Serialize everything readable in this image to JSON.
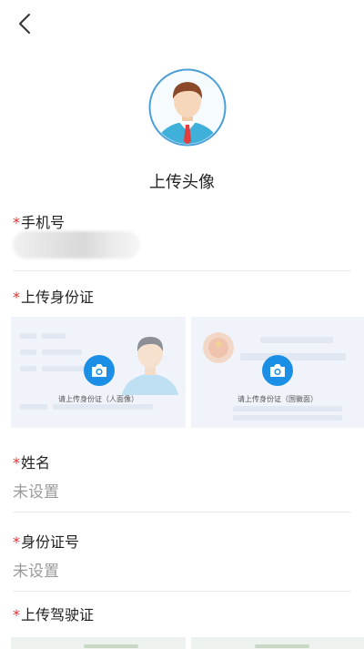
{
  "avatar": {
    "title": "上传头像"
  },
  "phone": {
    "label": "手机号",
    "required_mark": "*"
  },
  "id_card": {
    "label": "上传身份证",
    "required_mark": "*",
    "front_caption": "请上传身份证（人面像）",
    "back_caption": "请上传身份证（国徽面）"
  },
  "name": {
    "label": "姓名",
    "required_mark": "*",
    "value": "未设置"
  },
  "id_number": {
    "label": "身份证号",
    "required_mark": "*",
    "value": "未设置"
  },
  "license": {
    "label": "上传驾驶证",
    "required_mark": "*"
  },
  "colors": {
    "accent": "#1b8fe6",
    "required": "#e0302c",
    "placeholder": "#9a9a9a"
  },
  "icons": [
    "back-arrow-icon",
    "camera-icon"
  ]
}
